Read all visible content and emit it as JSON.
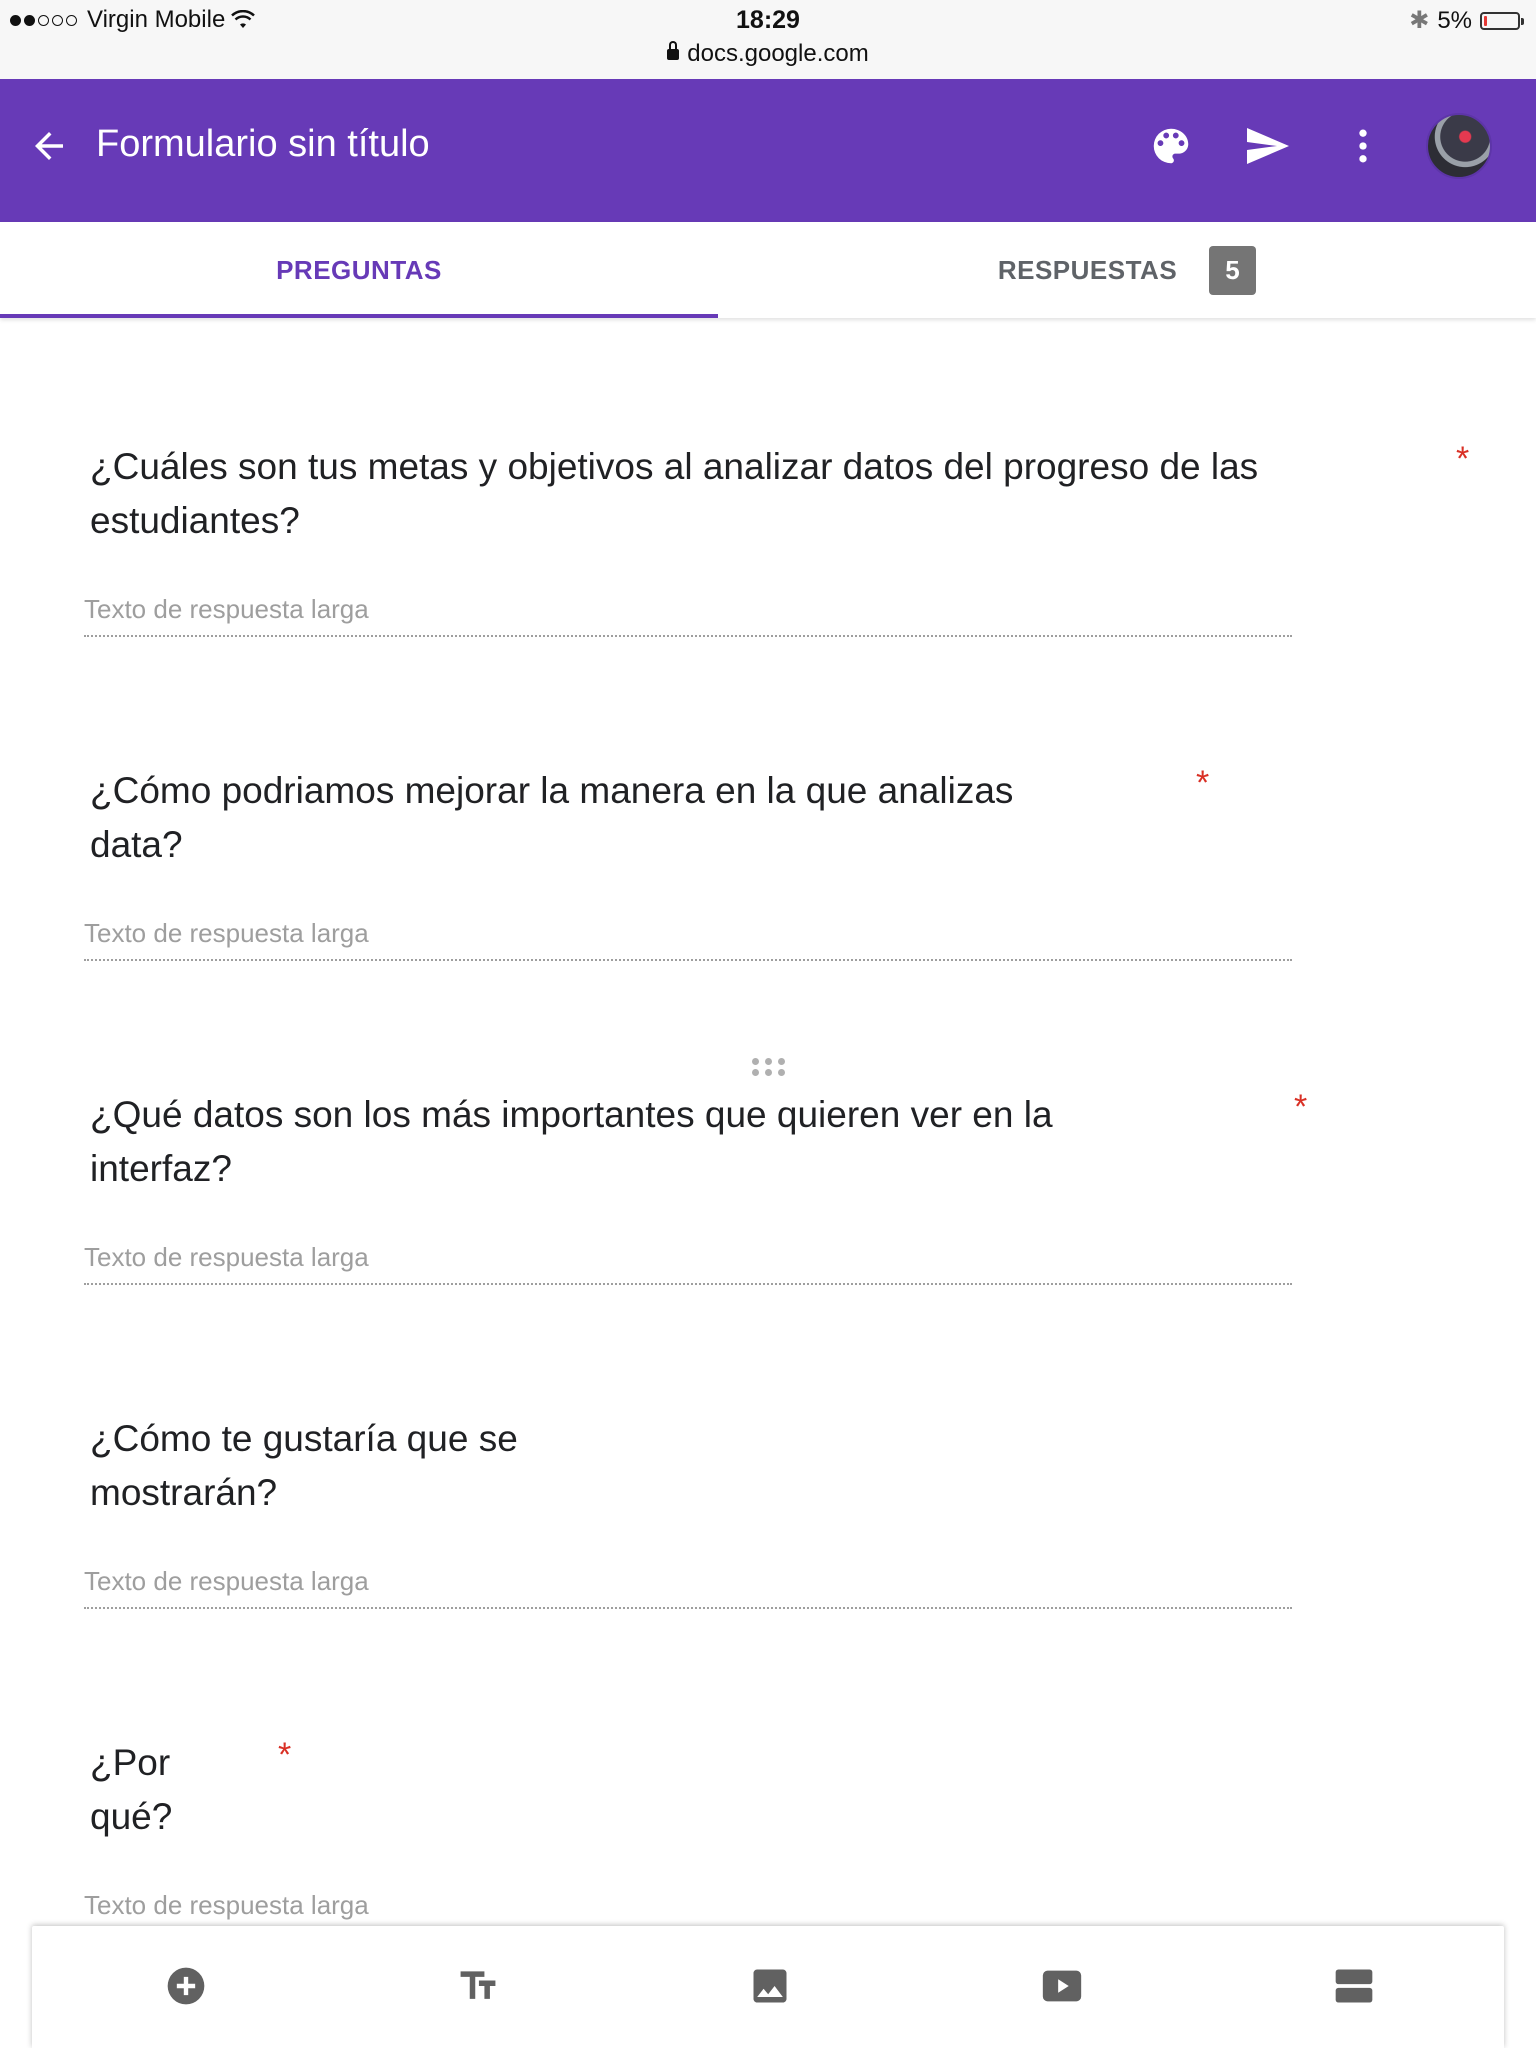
{
  "status_bar": {
    "carrier": "Virgin Mobile",
    "time": "18:29",
    "url": "docs.google.com",
    "battery": "5%",
    "signal_bars_filled": 2,
    "signal_bars_total": 5
  },
  "app_bar": {
    "title": "Formulario sin título",
    "icons": [
      "arrow-back-icon",
      "palette-icon",
      "send-icon",
      "more-vert-icon"
    ]
  },
  "tabs": {
    "questions": "PREGUNTAS",
    "responses": "RESPUESTAS",
    "responses_count": "5"
  },
  "questions": [
    {
      "title": "¿Cuáles son tus metas y objetivos al analizar datos del progreso de las estudiantes?",
      "required": true,
      "placeholder": "Texto de respuesta larga"
    },
    {
      "title": "¿Cómo podriamos mejorar la manera en la que analizas data?",
      "required": true,
      "placeholder": "Texto de respuesta larga"
    },
    {
      "title": "¿Qué datos son los más importantes que quieren ver en la interfaz?",
      "required": true,
      "placeholder": "Texto de respuesta larga"
    },
    {
      "title": "¿Cómo te gustaría que se mostrarán?",
      "required": false,
      "placeholder": "Texto de respuesta larga"
    },
    {
      "title": "¿Por qué?",
      "required": true,
      "placeholder": "Texto de respuesta larga"
    }
  ],
  "required_marker": "*",
  "toolbar": {
    "icons": [
      "add-question-icon",
      "title-text-icon",
      "image-icon",
      "video-icon",
      "section-icon"
    ]
  },
  "colors": {
    "accent": "#673ab7",
    "required": "#d93025",
    "badge": "#757575"
  }
}
